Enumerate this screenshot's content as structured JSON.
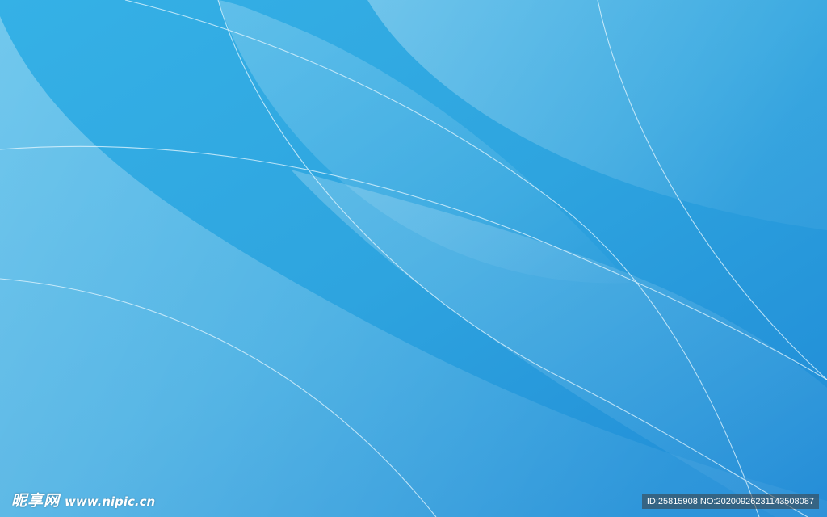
{
  "wallpaper": {
    "description_colors": {
      "base": "#2fa6df",
      "light": "#6fcdf0",
      "dark": "#1e88d4",
      "line": "#d9f3ff"
    }
  },
  "watermark": {
    "brand_cn": "昵享网",
    "brand_url": "www.nipic.cn",
    "id_text": "ID:25815908 NO:20200926231143508087"
  }
}
